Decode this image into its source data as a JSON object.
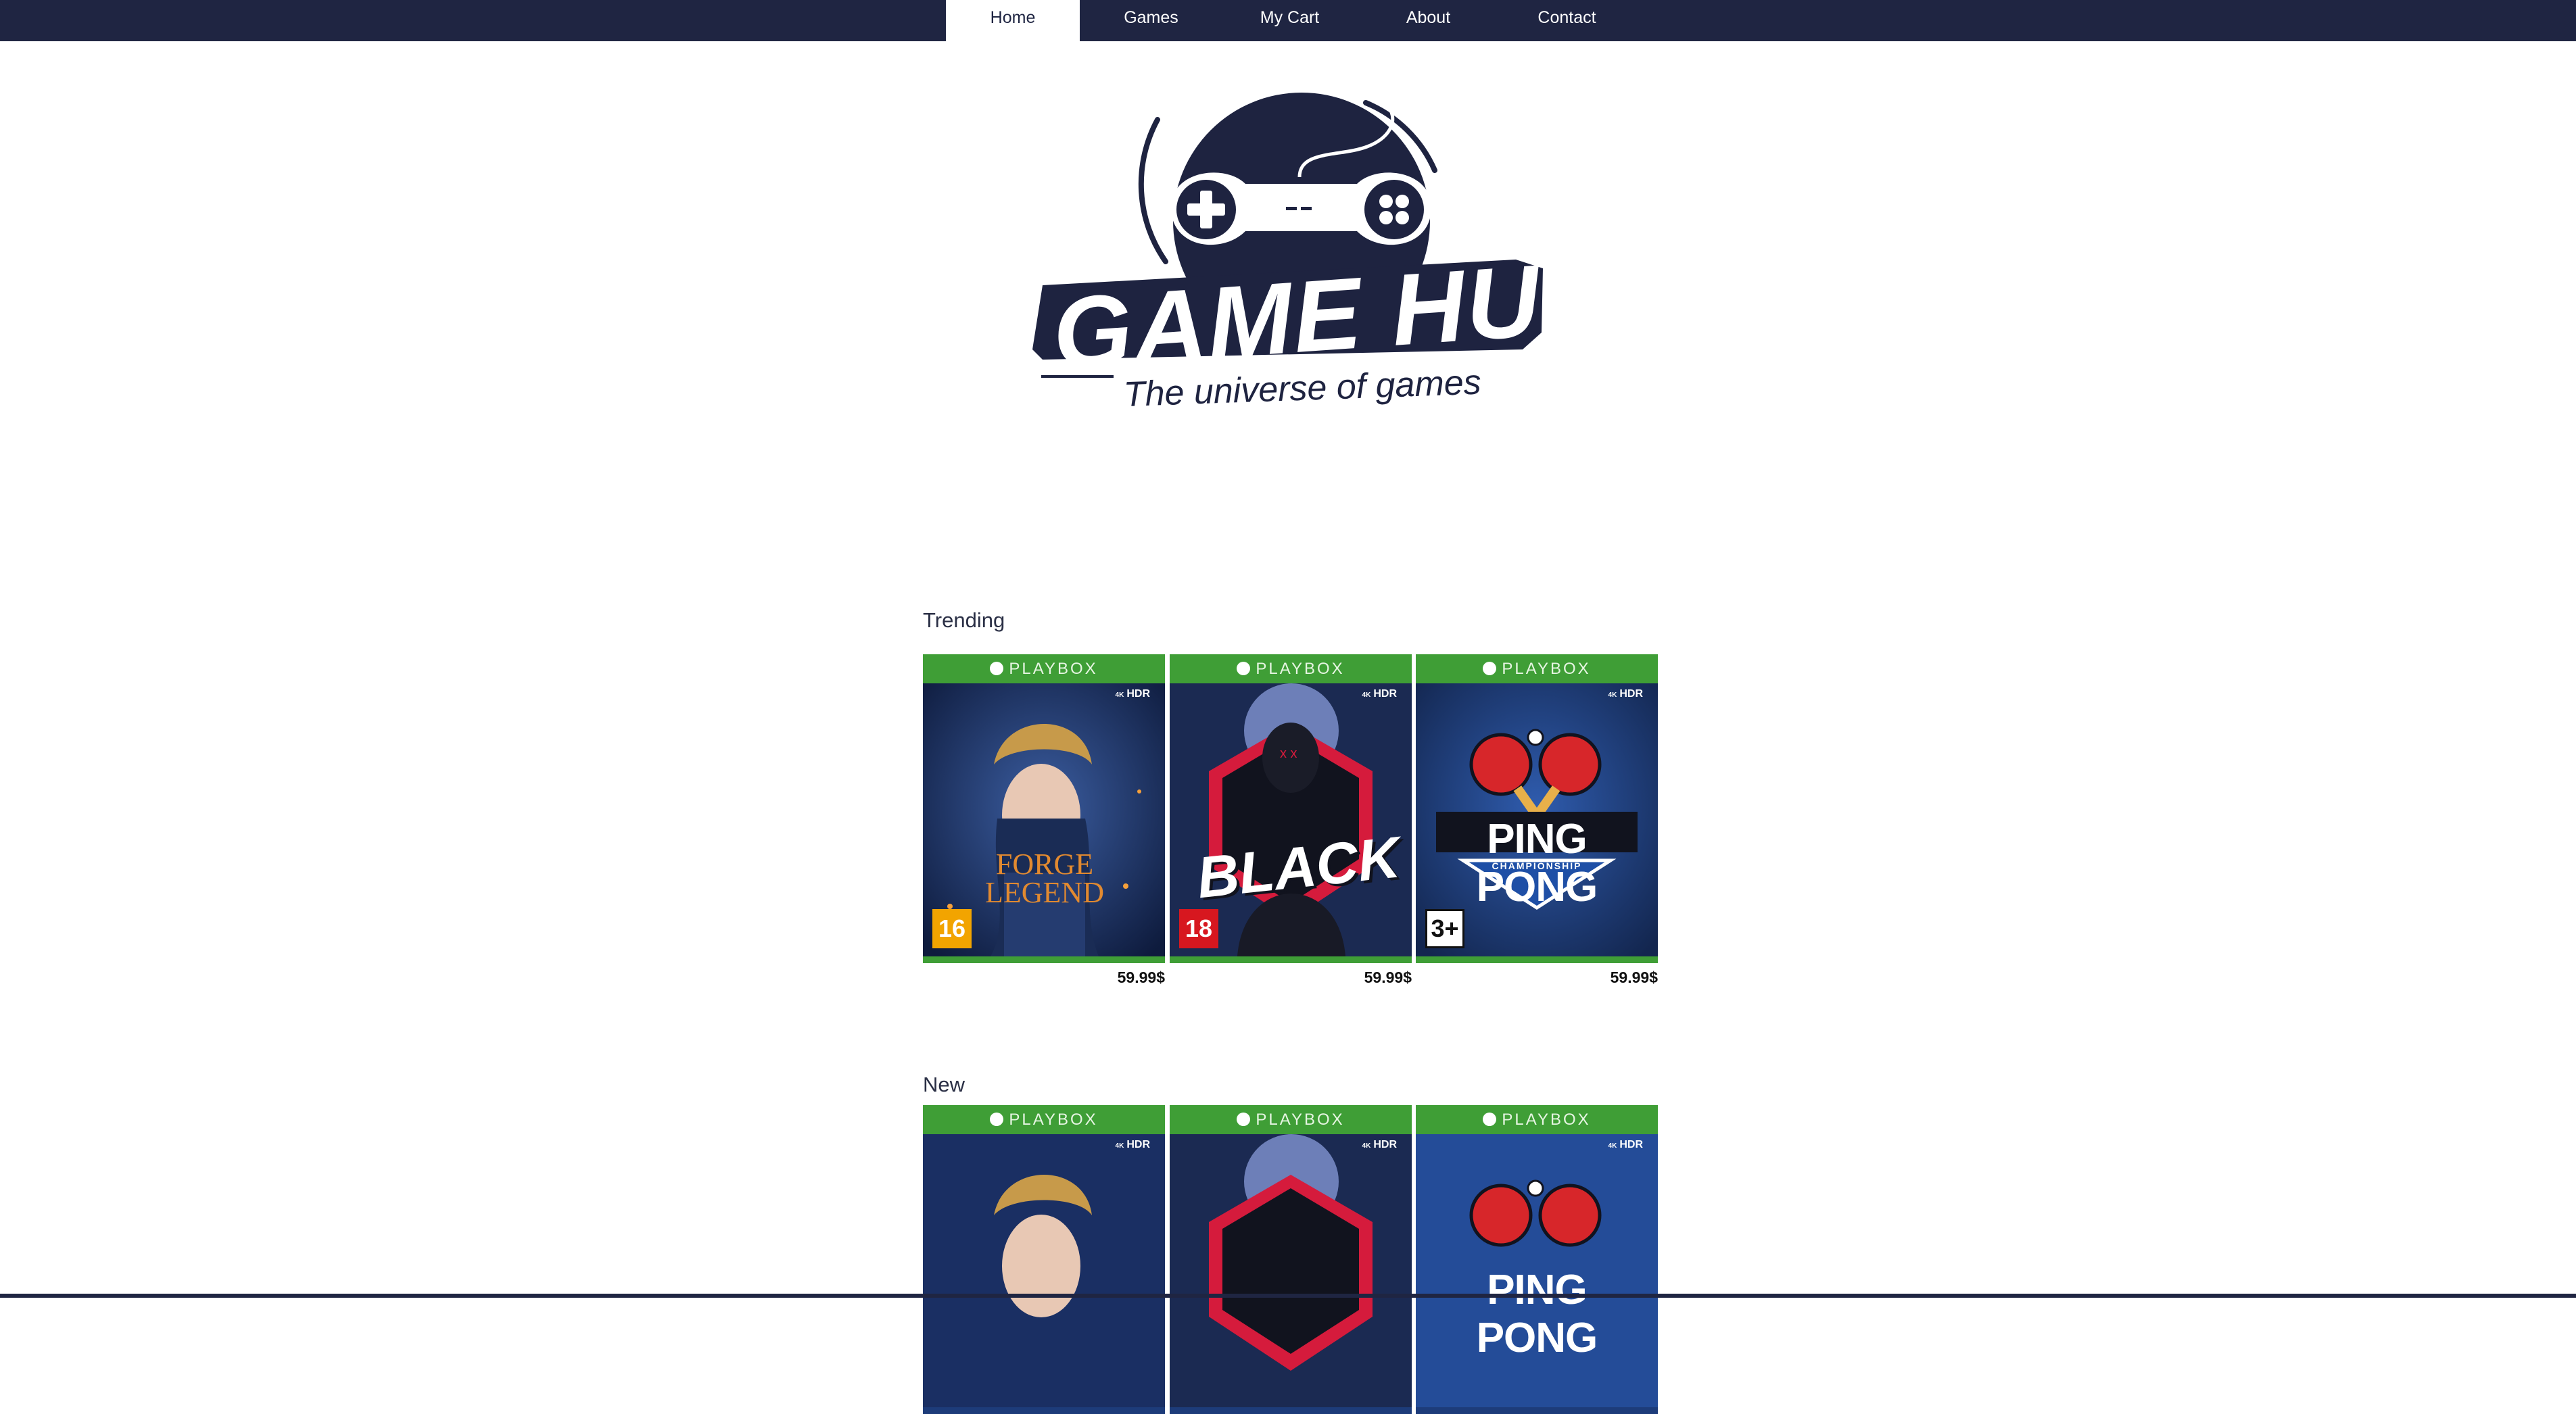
{
  "nav": {
    "items": [
      {
        "label": "Home",
        "active": true
      },
      {
        "label": "Games",
        "active": false
      },
      {
        "label": "My Cart",
        "active": false
      },
      {
        "label": "About",
        "active": false
      },
      {
        "label": "Contact",
        "active": false
      }
    ]
  },
  "logo": {
    "title": "GAME HUB",
    "tagline": "The universe of games"
  },
  "colors": {
    "nav_bg": "#1f2542",
    "brand_navy": "#1e2340",
    "cover_band_green": "#3f9e36"
  },
  "sections": [
    {
      "title": "Trending",
      "games": [
        {
          "brand": "PLAYBOX",
          "hdr": "HDR",
          "hdr_small": "4K",
          "cover_title": "FORGE LEGEND",
          "rating": "16",
          "price": "59.99$"
        },
        {
          "brand": "PLAYBOX",
          "hdr": "HDR",
          "hdr_small": "4K",
          "cover_title": "BLACK",
          "rating": "18",
          "price": "59.99$"
        },
        {
          "brand": "PLAYBOX",
          "hdr": "HDR",
          "hdr_small": "4K",
          "cover_title": "PING PONG",
          "cover_subtitle": "CHAMPIONSHIP",
          "rating": "3+",
          "price": "59.99$"
        }
      ]
    },
    {
      "title": "New",
      "games": [
        {
          "brand": "PLAYBOX",
          "hdr": "HDR",
          "hdr_small": "4K",
          "cover_title": "",
          "rating": "",
          "price": ""
        },
        {
          "brand": "PLAYBOX",
          "hdr": "HDR",
          "hdr_small": "4K",
          "cover_title": "",
          "rating": "",
          "price": ""
        },
        {
          "brand": "PLAYBOX",
          "hdr": "HDR",
          "hdr_small": "4K",
          "cover_title": "PING PONG",
          "rating": "",
          "price": ""
        }
      ]
    }
  ]
}
